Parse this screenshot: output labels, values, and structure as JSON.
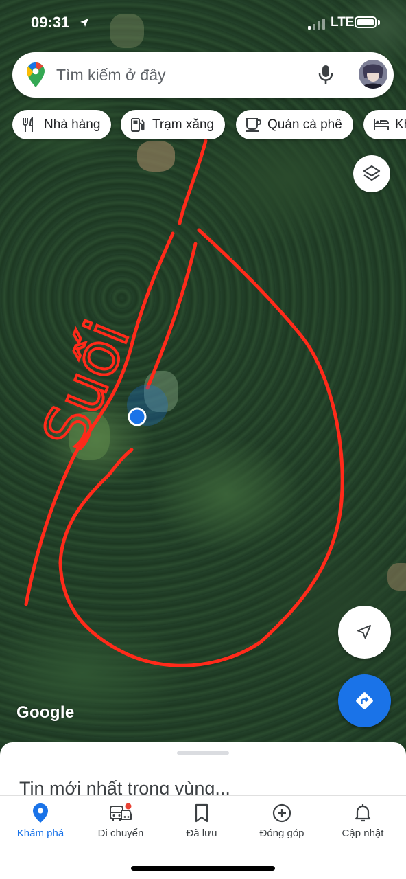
{
  "status_bar": {
    "time": "09:31",
    "network": "LTE"
  },
  "search": {
    "placeholder": "Tìm kiếm ở đây"
  },
  "chips": [
    {
      "label": "Nhà hàng",
      "icon": "restaurant-icon"
    },
    {
      "label": "Trạm xăng",
      "icon": "gas-station-icon"
    },
    {
      "label": "Quán cà phê",
      "icon": "coffee-icon"
    },
    {
      "label": "Kh",
      "icon": "hotel-icon"
    }
  ],
  "map": {
    "annotation_text": "Suối",
    "annotation_color": "#ff2a1a",
    "location_dot_color": "#1a73e8",
    "attribution": "Google"
  },
  "sheet": {
    "heading": "Tin mới nhất trong vùng..."
  },
  "bottom_nav": [
    {
      "label": "Khám phá",
      "icon": "explore-pin-icon",
      "active": true
    },
    {
      "label": "Di chuyển",
      "icon": "commute-icon",
      "active": false,
      "badge": true
    },
    {
      "label": "Đã lưu",
      "icon": "bookmark-icon",
      "active": false
    },
    {
      "label": "Đóng góp",
      "icon": "add-circle-icon",
      "active": false
    },
    {
      "label": "Cập nhật",
      "icon": "bell-icon",
      "active": false
    }
  ],
  "colors": {
    "accent": "#1a73e8",
    "badge": "#ea4335"
  }
}
